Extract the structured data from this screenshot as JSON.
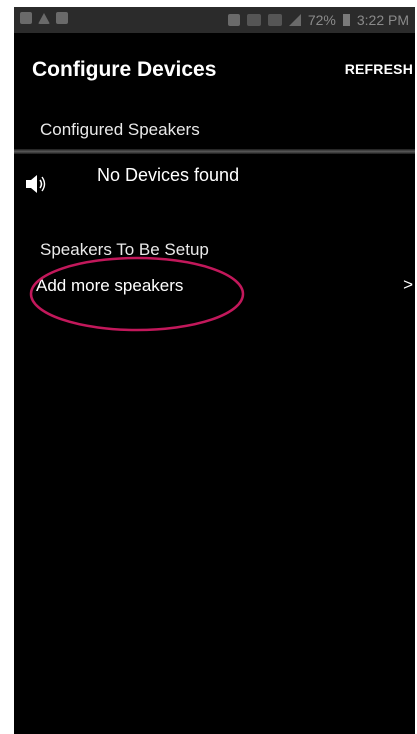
{
  "status_bar": {
    "battery": "72%",
    "time": "3:22 PM",
    "icons": [
      "notification-icon",
      "warning-icon",
      "image-icon",
      "nfc-icon",
      "mute-icon",
      "wifi-icon",
      "signal-icon",
      "battery-icon"
    ]
  },
  "header": {
    "title": "Configure Devices",
    "refresh_label": "REFRESH"
  },
  "configured": {
    "header": "Configured Speakers",
    "empty_message": "No Devices found",
    "icon": "speaker-icon"
  },
  "setup": {
    "header": "Speakers To Be Setup",
    "add_more_label": "Add more speakers",
    "chevron": ">"
  },
  "colors": {
    "background": "#000000",
    "text": "#ffffff",
    "annotation": "#c2185b"
  }
}
